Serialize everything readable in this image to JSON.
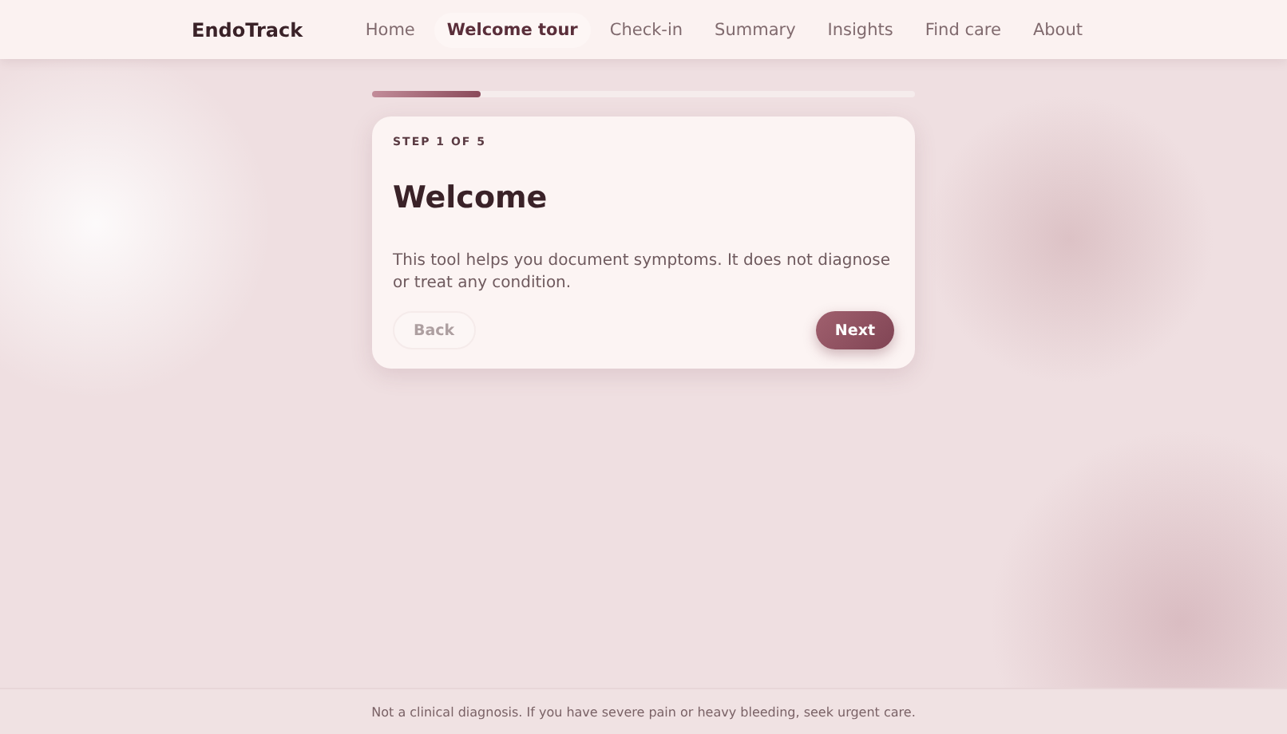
{
  "brand": "EndoTrack",
  "nav": [
    {
      "label": "Home",
      "selected": false
    },
    {
      "label": "Welcome tour",
      "selected": true
    },
    {
      "label": "Check-in",
      "selected": false
    },
    {
      "label": "Summary",
      "selected": false
    },
    {
      "label": "Insights",
      "selected": false
    },
    {
      "label": "Find care",
      "selected": false
    },
    {
      "label": "About",
      "selected": false
    }
  ],
  "progress": {
    "level": 0.2
  },
  "card": {
    "step": "STEP 1 OF 5",
    "title": "Welcome",
    "body": "This tool helps you document symptoms. It does not diagnose or treat any condition.",
    "buttons": [
      {
        "label": "Back",
        "kind": "secondary",
        "disabled": true
      },
      {
        "label": "Next",
        "kind": "primary",
        "disabled": false
      }
    ]
  },
  "footer": "Not a clinical diagnosis. If you have severe pain or heavy bleeding, seek urgent care."
}
